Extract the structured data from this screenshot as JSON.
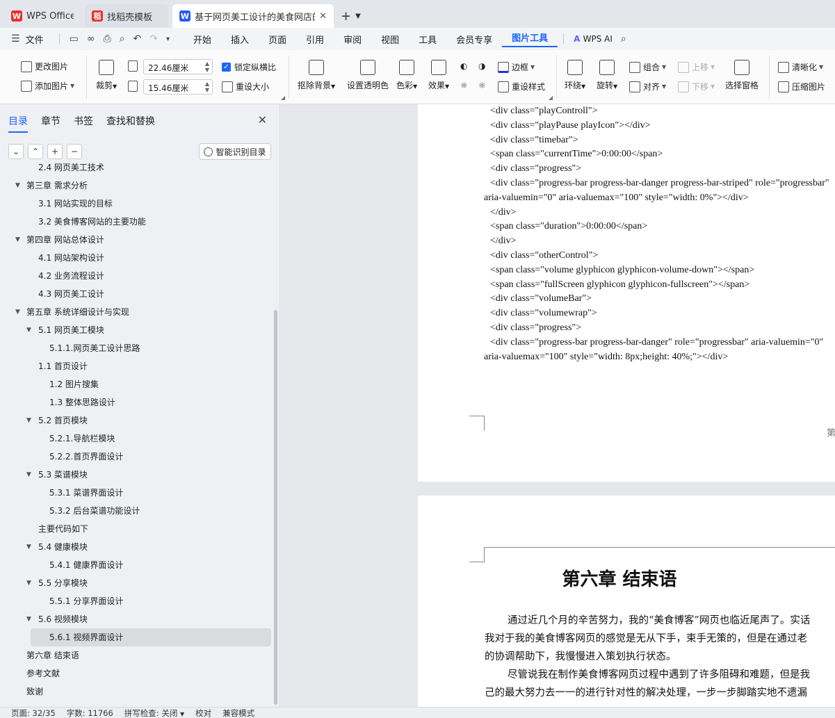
{
  "tabs": [
    {
      "label": "WPS Office",
      "icon": "wps-logo-icon",
      "color": "#e8322f"
    },
    {
      "label": "找稻壳模板",
      "icon": "docer-logo-icon",
      "color": "#e8322f"
    },
    {
      "label": "基于网页美工设计的美食网店的",
      "icon": "writer-logo-icon",
      "color": "#2b5cf0"
    }
  ],
  "tab_logo_letters": {
    "wps": "W",
    "docer": "稻",
    "writer": "W"
  },
  "menu": {
    "file": "文件",
    "items": [
      "开始",
      "插入",
      "页面",
      "引用",
      "审阅",
      "视图",
      "工具",
      "会员专享"
    ],
    "active": "图片工具",
    "ai": "WPS AI"
  },
  "ribbon": {
    "change_image": "更改图片",
    "add_image": "添加图片",
    "crop": "裁剪",
    "width": "22.46厘米",
    "height": "15.46厘米",
    "lock_ratio": "锁定纵横比",
    "reset_size": "重设大小",
    "remove_bg": "抠除背景",
    "set_transparent": "设置透明色",
    "color": "色彩",
    "effect": "效果",
    "border": "边框",
    "reset_style": "重设样式",
    "wrap": "环绕",
    "rotate": "旋转",
    "group": "组合",
    "align": "对齐",
    "move_up": "上移",
    "move_down": "下移",
    "selection_pane": "选择窗格",
    "sharpen": "清晰化",
    "compress": "压缩图片"
  },
  "nav": {
    "tabs": [
      "目录",
      "章节",
      "书签",
      "查找和替换"
    ],
    "smart_toc": "智能识别目录",
    "buttons": [
      "⌄",
      "⌃",
      "+",
      "−"
    ],
    "toc": [
      {
        "text": "2.4  网页美工技术",
        "level": 2,
        "toggle": false
      },
      {
        "text": "第三章  需求分析",
        "level": 1,
        "toggle": true
      },
      {
        "text": "3.1 网站实现的目标",
        "level": 2,
        "toggle": false
      },
      {
        "text": "3.2 美食博客网站的主要功能",
        "level": 2,
        "toggle": false
      },
      {
        "text": "第四章  网站总体设计",
        "level": 1,
        "toggle": true
      },
      {
        "text": "4.1 网站架构设计",
        "level": 2,
        "toggle": false
      },
      {
        "text": "4.2 业务流程设计",
        "level": 2,
        "toggle": false
      },
      {
        "text": "4.3 网页美工设计",
        "level": 2,
        "toggle": false
      },
      {
        "text": "第五章  系统详细设计与实现",
        "level": 1,
        "toggle": true
      },
      {
        "text": "5.1 网页美工模块",
        "level": 2,
        "toggle": true
      },
      {
        "text": "5.1.1.网页美工设计思路",
        "level": 3,
        "toggle": false
      },
      {
        "text": "1.1 首页设计",
        "level": 2,
        "toggle": false
      },
      {
        "text": "1.2 图片搜集",
        "level": 3,
        "toggle": false
      },
      {
        "text": "1.3 整体思路设计",
        "level": 3,
        "toggle": false
      },
      {
        "text": "5.2 首页模块",
        "level": 2,
        "toggle": true
      },
      {
        "text": "5.2.1.导航栏模块",
        "level": 3,
        "toggle": false
      },
      {
        "text": "5.2.2.首页界面设计",
        "level": 3,
        "toggle": false
      },
      {
        "text": "5.3 菜谱模块",
        "level": 2,
        "toggle": true
      },
      {
        "text": "5.3.1 菜谱界面设计",
        "level": 3,
        "toggle": false
      },
      {
        "text": "5.3.2 后台菜谱功能设计",
        "level": 3,
        "toggle": false
      },
      {
        "text": "主要代码如下",
        "level": 2,
        "toggle": false
      },
      {
        "text": "5.4 健康模块",
        "level": 2,
        "toggle": true
      },
      {
        "text": "5.4.1  健康界面设计",
        "level": 3,
        "toggle": false
      },
      {
        "text": "5.5 分享模块",
        "level": 2,
        "toggle": true
      },
      {
        "text": "5.5.1 分享界面设计",
        "level": 3,
        "toggle": false
      },
      {
        "text": "5.6 视频模块",
        "level": 2,
        "toggle": true
      },
      {
        "text": "5.6.1 视频界面设计",
        "level": 3,
        "toggle": false,
        "selected": true
      },
      {
        "text": "第六章  结束语",
        "level": 1,
        "toggle": false
      },
      {
        "text": "参考文献",
        "level": 1,
        "toggle": false
      },
      {
        "text": "致谢",
        "level": 0,
        "toggle": false
      }
    ]
  },
  "document": {
    "code_lines": [
      "<div class=\"playControll\">",
      "<div class=\"playPause playIcon\"></div>",
      "<div class=\"timebar\">",
      "<span class=\"currentTime\">0:00:00</span>",
      "<div class=\"progress\">",
      "<div   class=\"progress-bar   progress-bar-danger   progress-bar-striped\"   role=\"progressbar\"",
      "aria-valuemin=\"0\" aria-valuemax=\"100\" style=\"width: 0%\"></div>",
      "</div>",
      "<span class=\"duration\">0:00:00</span>",
      "</div>",
      "<div class=\"otherControl\">",
      "<span class=\"volume glyphicon glyphicon-volume-down\"></span>",
      "<span class=\"fullScreen glyphicon glyphicon-fullscreen\"></span>",
      "<div class=\"volumeBar\">",
      "<div class=\"volumewrap\">",
      "<div class=\"progress\">",
      "<div    class=\"progress-bar    progress-bar-danger\"    role=\"progressbar\"    aria-valuemin=\"0\"",
      "aria-valuemax=\"100\" style=\"width: 8px;height: 40%;\"></div>"
    ],
    "page_footer_fragment": "第",
    "chapter_title": "第六章  结束语",
    "paragraphs": [
      "通过近几个月的辛苦努力，我的“美食博客”网页也临近尾声了。实话",
      "我对于我的美食博客网页的感觉是无从下手，束手无策的，但是在通过老",
      "的协调帮助下，我慢慢进入策划执行状态。",
      "尽管说我在制作美食博客网页过程中遇到了许多阻碍和难题，但是我",
      "己的最大努力去一一的进行针对性的解决处理，一步一步脚踏实地不遗漏"
    ]
  },
  "status": {
    "page": "页面: 32/35",
    "words": "字数: 11766",
    "spell": "拼写检查: 关闭",
    "proof": "校对",
    "compat": "兼容模式"
  }
}
